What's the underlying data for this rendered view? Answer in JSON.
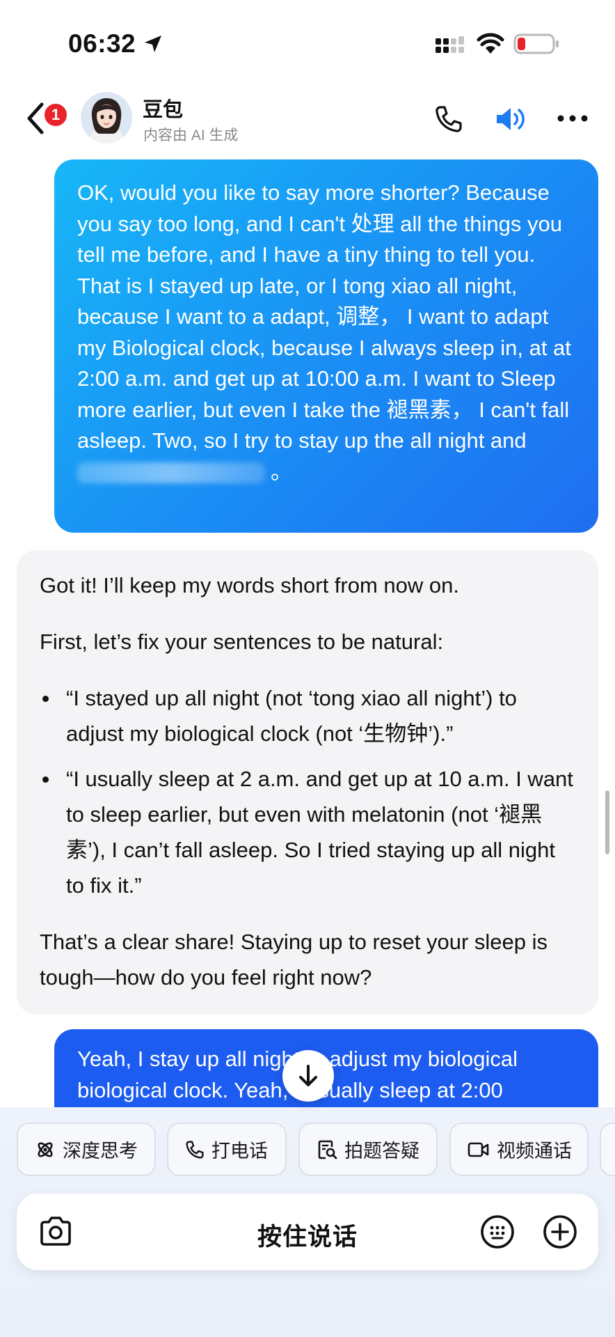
{
  "status_bar": {
    "time": "06:32"
  },
  "header": {
    "unread_count": "1",
    "bot_name": "豆包",
    "bot_subtitle": "内容由 AI 生成"
  },
  "messages": {
    "user_1": {
      "text": "OK, would you like to say more shorter? Because you say too long, and I can't 处理 all the things you tell me before, and I have a tiny thing to tell you. That is I stayed up late, or I tong xiao all night, because I want to a adapt, 调整， I want to adapt my Biological clock, because I always sleep in, at at 2:00 a.m. and get up at 10:00 a.m. I want to Sleep more earlier, but even I take the 褪黑素， I can't fall asleep. Two, so I try to stay up the all night and",
      "tail": "。"
    },
    "bot_1": {
      "intro": "Got it! I’ll keep my words short from now on.",
      "lead": "First, let’s fix your sentences to be natural:",
      "bullets": [
        "“I stayed up all night (not ‘tong xiao all night’) to adjust my biological clock (not ‘生物钟’).”",
        "“I usually sleep at 2 a.m. and get up at 10 a.m. I want to sleep earlier, but even with melatonin (not ‘褪黑素’), I can’t fall asleep. So I tried staying up all night to fix it.”"
      ],
      "closing": "That’s a clear share! Staying up to reset your sleep is tough—how do you feel right now?"
    },
    "user_2": {
      "text": "Yeah, I stay up all night to adjust my biological biological clock. Yeah, I usually sleep at 2:00"
    }
  },
  "quick_actions": [
    {
      "label": "深度思考",
      "icon": "atom-icon"
    },
    {
      "label": "打电话",
      "icon": "phone-icon"
    },
    {
      "label": "拍题答疑",
      "icon": "scan-doc-icon"
    },
    {
      "label": "视频通话",
      "icon": "video-icon"
    }
  ],
  "input_bar": {
    "voice_label": "按住说话"
  },
  "colors": {
    "user_bubble_gradient_start": "#17b7f7",
    "user_bubble_gradient_end": "#1f6ef0",
    "user_bubble_dark": "#1d5cf0",
    "bot_bubble": "#f4f4f6",
    "badge_red": "#e8232c",
    "speaker_blue": "#1e7cf2",
    "battery_low_red": "#e8232c"
  }
}
